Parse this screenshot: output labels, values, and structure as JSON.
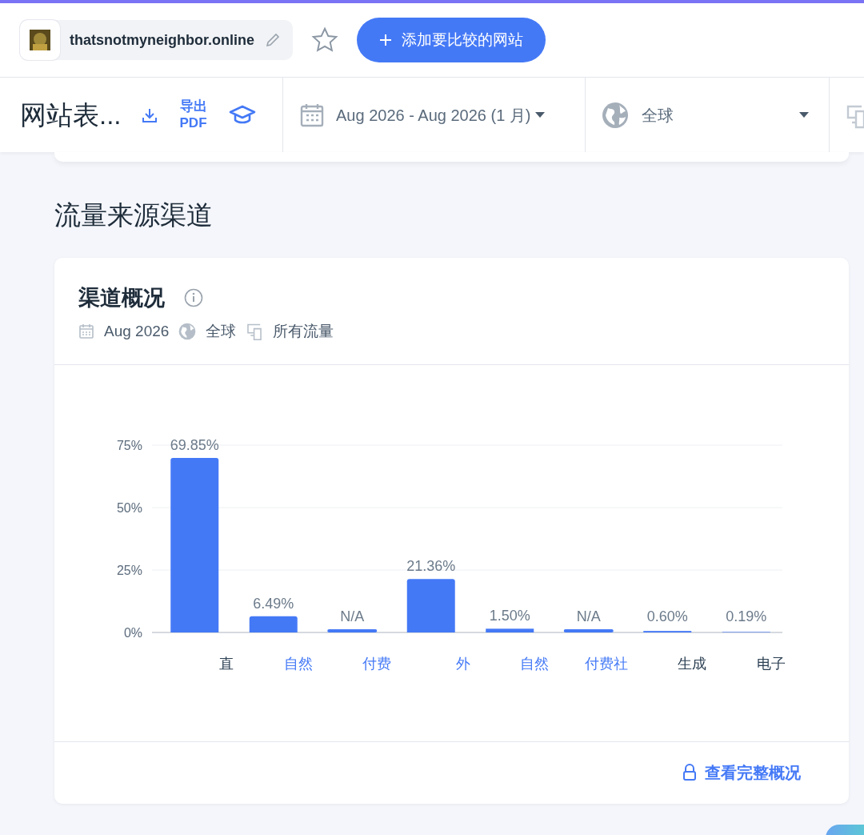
{
  "site": {
    "domain": "thatsnotmyneighbor.online",
    "favorited": false
  },
  "compare_button": {
    "label": "添加要比较的网站"
  },
  "toolbar": {
    "title": "网站表...",
    "export_label": "导出 PDF",
    "date_range": "Aug 2026 - Aug 2026 (1 月)",
    "region": "全球"
  },
  "section_title": "流量来源渠道",
  "card": {
    "title": "渠道概况",
    "filters": [
      {
        "kind": "date",
        "label": "Aug 2026"
      },
      {
        "kind": "region",
        "label": "全球"
      },
      {
        "kind": "device",
        "label": "所有流量"
      }
    ],
    "chart_data": {
      "type": "bar",
      "categories": [
        "直",
        "自然",
        "付费",
        "外",
        "自然",
        "付费社",
        "生成",
        "电子"
      ],
      "series": [
        {
          "color": "#4479f6",
          "values": [
            69.85,
            6.49,
            null,
            21.36,
            1.5,
            null,
            0.6,
            0.19
          ]
        }
      ],
      "ylim": [
        0,
        75
      ],
      "yticks": [
        {
          "value": 0,
          "label": "0%"
        },
        {
          "value": 25,
          "label": "25%"
        },
        {
          "value": 50,
          "label": "50%"
        },
        {
          "value": 75,
          "label": "75%"
        }
      ],
      "value_labels": [
        "69.85%",
        "6.49%",
        "N/A",
        "21.36%",
        "1.50%",
        "N/A",
        "0.60%",
        "0.19%"
      ]
    },
    "category_links": [
      false,
      true,
      true,
      true,
      true,
      true,
      false,
      false
    ],
    "footer_link": "查看完整概况"
  }
}
